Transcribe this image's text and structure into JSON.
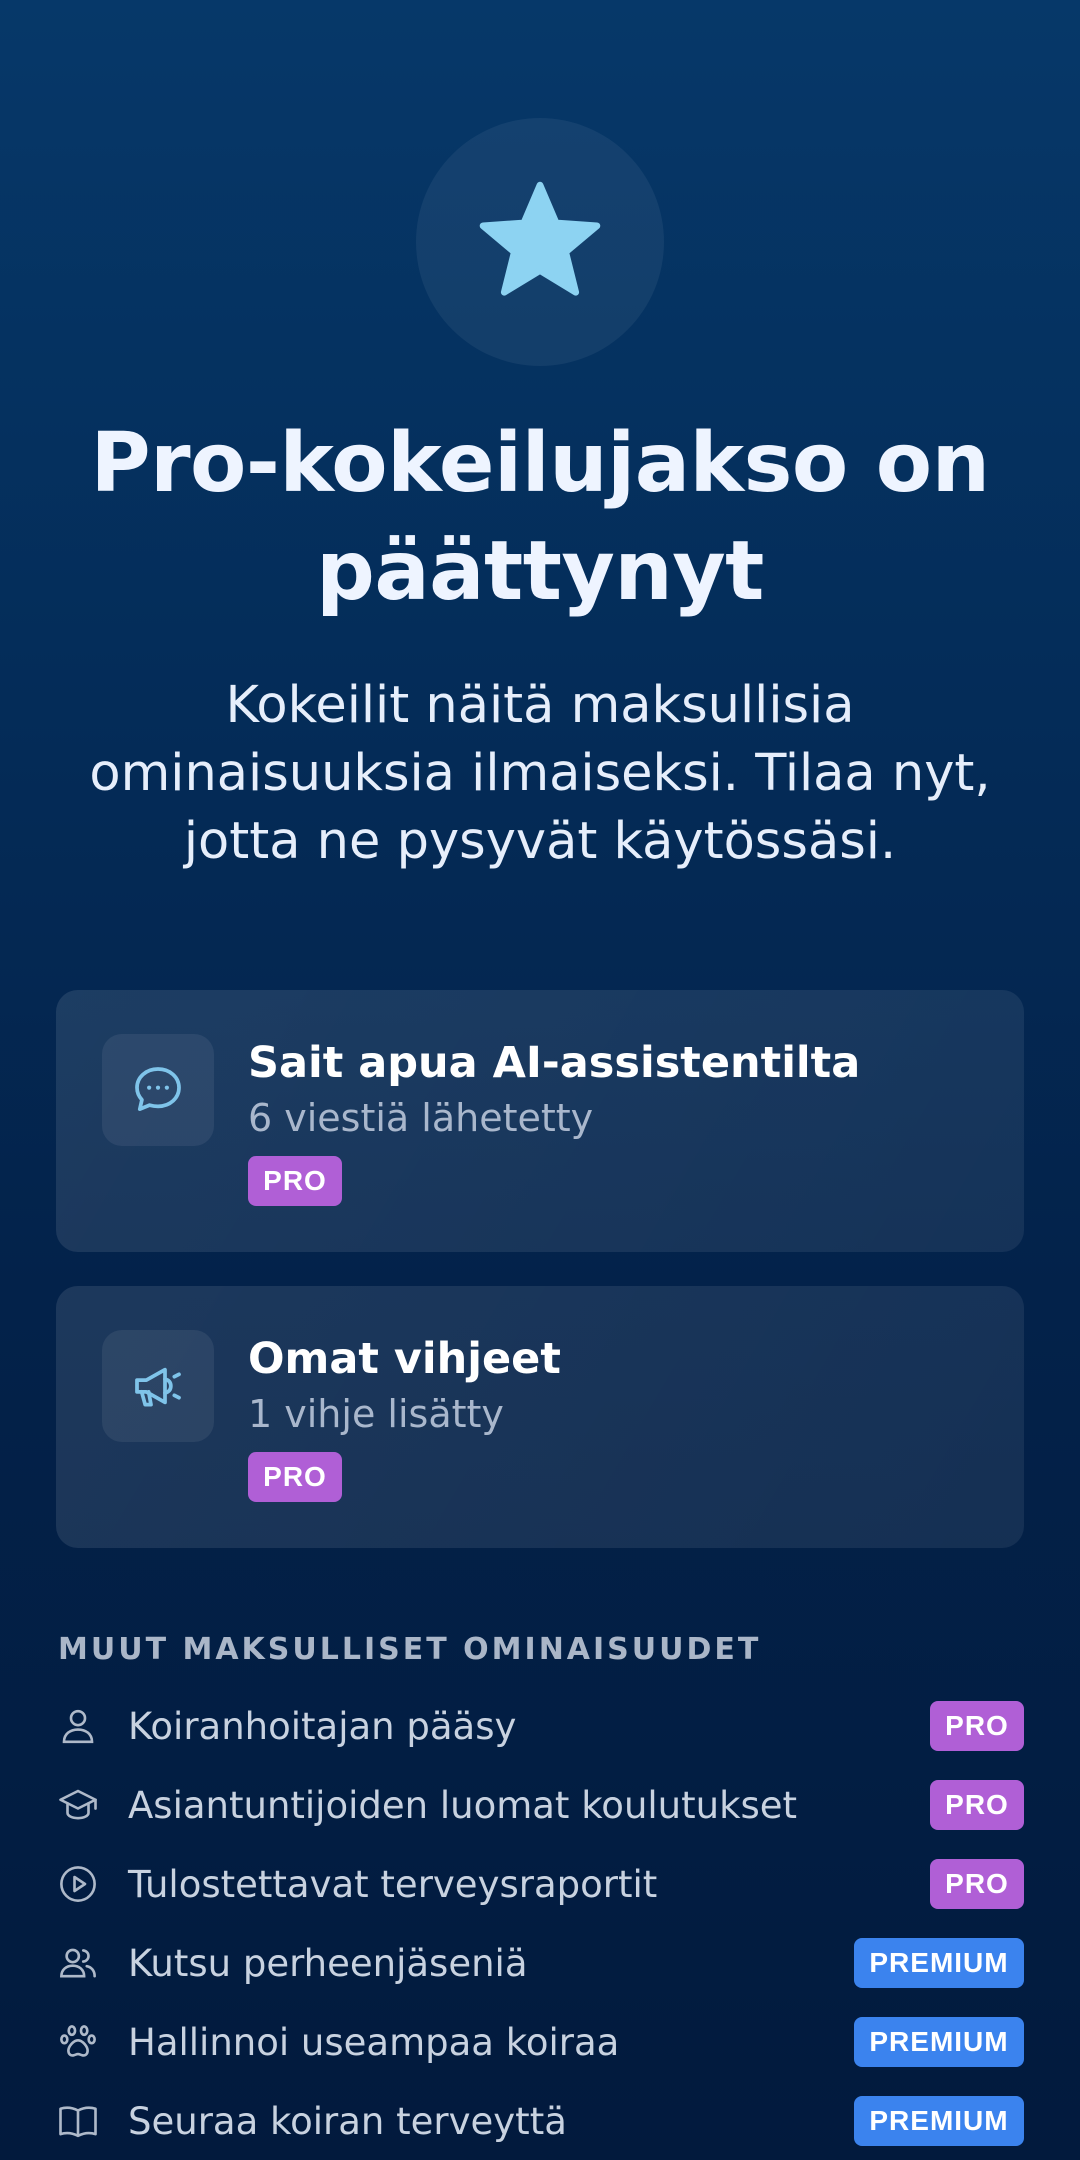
{
  "hero": {
    "icon": "star-icon",
    "title": "Pro-kokeilujakso on päättynyt",
    "subtitle": "Kokeilit näitä maksullisia ominaisuuksia ilmaiseksi. Tilaa nyt, jotta ne pysyvät käytössäsi."
  },
  "cards": [
    {
      "icon": "chat-bubble-icon",
      "title": "Sait apua AI-assistentilta",
      "subtitle": "6 viestiä lähetetty",
      "badge": "PRO"
    },
    {
      "icon": "megaphone-icon",
      "title": "Omat vihjeet",
      "subtitle": "1 vihje lisätty",
      "badge": "PRO"
    }
  ],
  "other_features": {
    "heading": "MUUT MAKSULLISET OMINAISUUDET",
    "items": [
      {
        "icon": "person-icon",
        "label": "Koiranhoitajan pääsy",
        "badge": "PRO"
      },
      {
        "icon": "graduation-cap-icon",
        "label": "Asiantuntijoiden luomat koulutukset",
        "badge": "PRO"
      },
      {
        "icon": "play-circle-icon",
        "label": "Tulostettavat terveysraportit",
        "badge": "PRO"
      },
      {
        "icon": "people-icon",
        "label": "Kutsu perheenjäseniä",
        "badge": "PREMIUM"
      },
      {
        "icon": "paw-icon",
        "label": "Hallinnoi useampaa koiraa",
        "badge": "PREMIUM"
      },
      {
        "icon": "open-book-icon",
        "label": "Seuraa koiran terveyttä",
        "badge": "PREMIUM"
      }
    ]
  },
  "colors": {
    "background_top": "#063869",
    "background_bottom": "#021a3d",
    "accent_star": "#8dd3f2",
    "badge_pro": "#b05fd6",
    "badge_premium": "#3b83ee"
  }
}
